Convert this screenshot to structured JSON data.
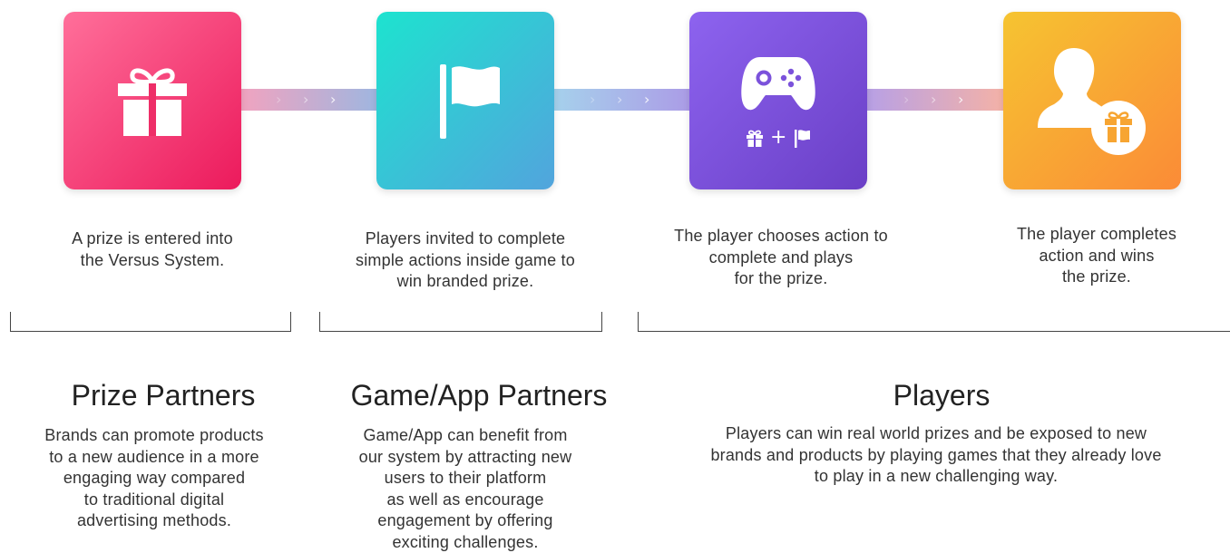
{
  "steps": [
    {
      "icon": "gift-icon",
      "caption_lines": [
        "A prize is entered into",
        "the Versus System."
      ],
      "colors": [
        "#ff6f9a",
        "#ec1a5c"
      ]
    },
    {
      "icon": "flag-icon",
      "caption_lines": [
        "Players invited to complete",
        "simple actions inside game to",
        "win branded prize."
      ],
      "colors": [
        "#1de3cf",
        "#52a4dd"
      ]
    },
    {
      "icon": "gamepad-icon",
      "sub_icons": [
        "gift-icon",
        "plus-icon",
        "flag-icon"
      ],
      "sub_plus": "+",
      "caption_lines": [
        "The player chooses action to",
        "complete and plays",
        "for the prize."
      ],
      "colors": [
        "#8d63ef",
        "#6a3fc6"
      ]
    },
    {
      "icon": "user-gift-icon",
      "caption_lines": [
        "The player completes",
        "action and wins",
        "the prize."
      ],
      "colors": [
        "#f6c431",
        "#fb8b37"
      ]
    }
  ],
  "connectors": [
    {
      "chevrons": [
        "›",
        "›",
        "›"
      ],
      "colors": [
        "#f3a3bf",
        "#9eb6e0"
      ]
    },
    {
      "chevrons": [
        "›",
        "›",
        "›"
      ],
      "colors": [
        "#a6d2ec",
        "#ab9be6"
      ]
    },
    {
      "chevrons": [
        "›",
        "›",
        "›"
      ],
      "colors": [
        "#b7a0e6",
        "#f5b2a6"
      ]
    }
  ],
  "groups": [
    {
      "title": "Prize Partners",
      "desc_lines": [
        "Brands can promote products",
        "to a new audience in a more",
        "engaging way compared",
        "to traditional digital",
        "advertising methods."
      ]
    },
    {
      "title": "Game/App Partners",
      "desc_lines": [
        "Game/App can benefit from",
        "our system by attracting new",
        "users to their platform",
        "as well as encourage",
        "engagement by offering",
        "exciting challenges."
      ]
    },
    {
      "title": "Players",
      "desc_lines": [
        "Players can win real world prizes and be exposed to new",
        "brands and products by playing games that they already love",
        "to play in a new challenging way."
      ]
    }
  ]
}
